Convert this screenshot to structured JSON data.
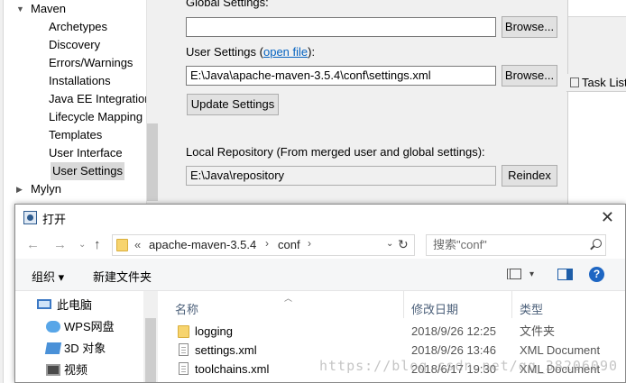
{
  "tree": {
    "maven": "Maven",
    "items": [
      "Archetypes",
      "Discovery",
      "Errors/Warnings",
      "Installations",
      "Java EE Integration",
      "Lifecycle Mapping",
      "Templates",
      "User Interface",
      "User Settings"
    ],
    "selected": "User Settings",
    "mylyn": "Mylyn"
  },
  "prefs": {
    "global_label": "Global Settings:",
    "global_value": "",
    "browse": "Browse...",
    "user_label_prefix": "User Settings (",
    "user_label_link": "open file",
    "user_label_suffix": "):",
    "user_value": "E:\\Java\\apache-maven-3.5.4\\conf\\settings.xml",
    "update": "Update Settings",
    "local_label": "Local Repository (From merged user and global settings):",
    "local_value": "E:\\Java\\repository",
    "reindex": "Reindex"
  },
  "task_list": "Task List",
  "dialog": {
    "title": "打开",
    "breadcrumbs": [
      "«",
      "apache-maven-3.5.4",
      "›",
      "conf",
      "›"
    ],
    "search_placeholder": "搜索\"conf\"",
    "organize": "组织 ▾",
    "new_folder": "新建文件夹",
    "columns": {
      "name": "名称",
      "date": "修改日期",
      "type": "类型"
    },
    "sidebar": [
      "此电脑",
      "WPS网盘",
      "3D 对象",
      "视频"
    ],
    "files": [
      {
        "name": "logging",
        "date": "2018/9/26 12:25",
        "type": "文件夹",
        "kind": "folder"
      },
      {
        "name": "settings.xml",
        "date": "2018/9/26 13:46",
        "type": "XML Document",
        "kind": "file"
      },
      {
        "name": "toolchains.xml",
        "date": "2018/6/17 19:30",
        "type": "XML Document",
        "kind": "file"
      }
    ]
  },
  "watermark": "https://blog.csdn.net/qq_38206090"
}
